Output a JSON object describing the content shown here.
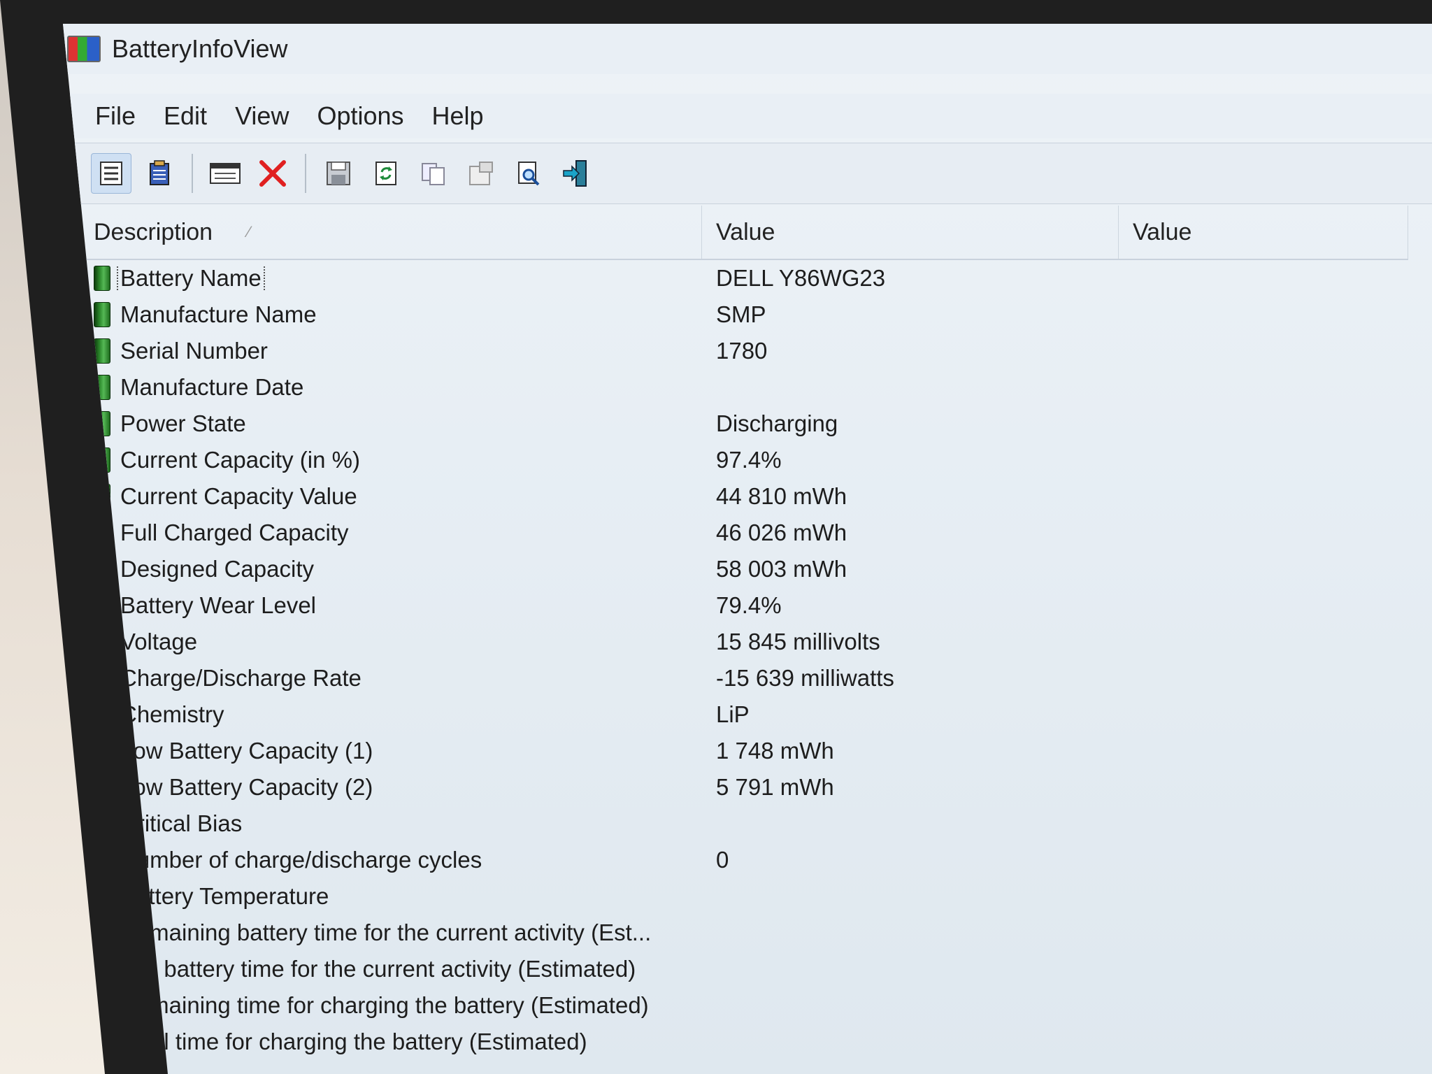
{
  "window": {
    "title": "BatteryInfoView"
  },
  "menu": [
    "File",
    "Edit",
    "View",
    "Options",
    "Help"
  ],
  "toolbar": {
    "icons": [
      "details-view-icon",
      "html-report-icon",
      "properties-icon",
      "delete-icon",
      "save-icon",
      "refresh-icon",
      "copy-icon",
      "properties-sheet-icon",
      "find-icon",
      "exit-icon"
    ]
  },
  "table": {
    "headers": {
      "description": "Description",
      "value1": "Value",
      "value2": "Value"
    },
    "rows": [
      {
        "label": "Battery Name",
        "value": "DELL Y86WG23"
      },
      {
        "label": "Manufacture Name",
        "value": "SMP"
      },
      {
        "label": "Serial Number",
        "value": "1780"
      },
      {
        "label": "Manufacture Date",
        "value": ""
      },
      {
        "label": "Power State",
        "value": "Discharging"
      },
      {
        "label": "Current Capacity (in %)",
        "value": "97.4%"
      },
      {
        "label": "Current Capacity Value",
        "value": "44 810 mWh"
      },
      {
        "label": "Full Charged Capacity",
        "value": "46 026 mWh"
      },
      {
        "label": "Designed Capacity",
        "value": "58 003 mWh"
      },
      {
        "label": "Battery Wear Level",
        "value": "79.4%"
      },
      {
        "label": "Voltage",
        "value": "15 845 millivolts"
      },
      {
        "label": "Charge/Discharge Rate",
        "value": "-15 639 milliwatts"
      },
      {
        "label": "Chemistry",
        "value": "LiP"
      },
      {
        "label": "Low Battery Capacity (1)",
        "value": "1 748 mWh"
      },
      {
        "label": "Low Battery Capacity (2)",
        "value": "5 791 mWh"
      },
      {
        "label": "Critical Bias",
        "value": ""
      },
      {
        "label": "Number of charge/discharge cycles",
        "value": "0"
      },
      {
        "label": "Battery Temperature",
        "value": ""
      },
      {
        "label": "Remaining battery time for the current activity (Est...",
        "value": ""
      },
      {
        "label": "Full battery time for the current activity (Estimated)",
        "value": ""
      },
      {
        "label": "Remaining time for charging the battery (Estimated)",
        "value": ""
      },
      {
        "label": "Total  time for charging the battery (Estimated)",
        "value": ""
      }
    ]
  },
  "colors": {
    "battery_icon": "#2d8a2d",
    "delete_icon": "#e02020"
  }
}
